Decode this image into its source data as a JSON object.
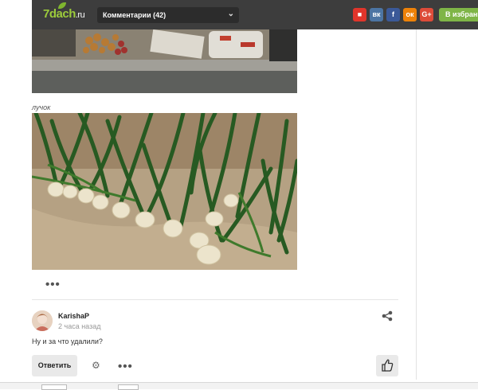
{
  "header": {
    "logo": "7dach",
    "logo_suffix": ".ru",
    "comments_label": "Комментарии (42)",
    "social": [
      {
        "name": "bookmark",
        "glyph": "■",
        "color": "#e0352b"
      },
      {
        "name": "vk",
        "glyph": "вк",
        "color": "#4c75a3"
      },
      {
        "name": "facebook",
        "glyph": "f",
        "color": "#3b5998"
      },
      {
        "name": "odnoklassniki",
        "glyph": "ок",
        "color": "#ee8208"
      },
      {
        "name": "google-plus",
        "glyph": "G+",
        "color": "#dd4b39"
      }
    ],
    "favorites_label": "В избранное"
  },
  "article": {
    "caption": "лучок",
    "more_dots": "•••"
  },
  "comment": {
    "author": "KarishaP",
    "time": "2 часа назад",
    "text": "Ну и за что удалили?",
    "reply_label": "Ответить",
    "more_dots": "•••"
  }
}
